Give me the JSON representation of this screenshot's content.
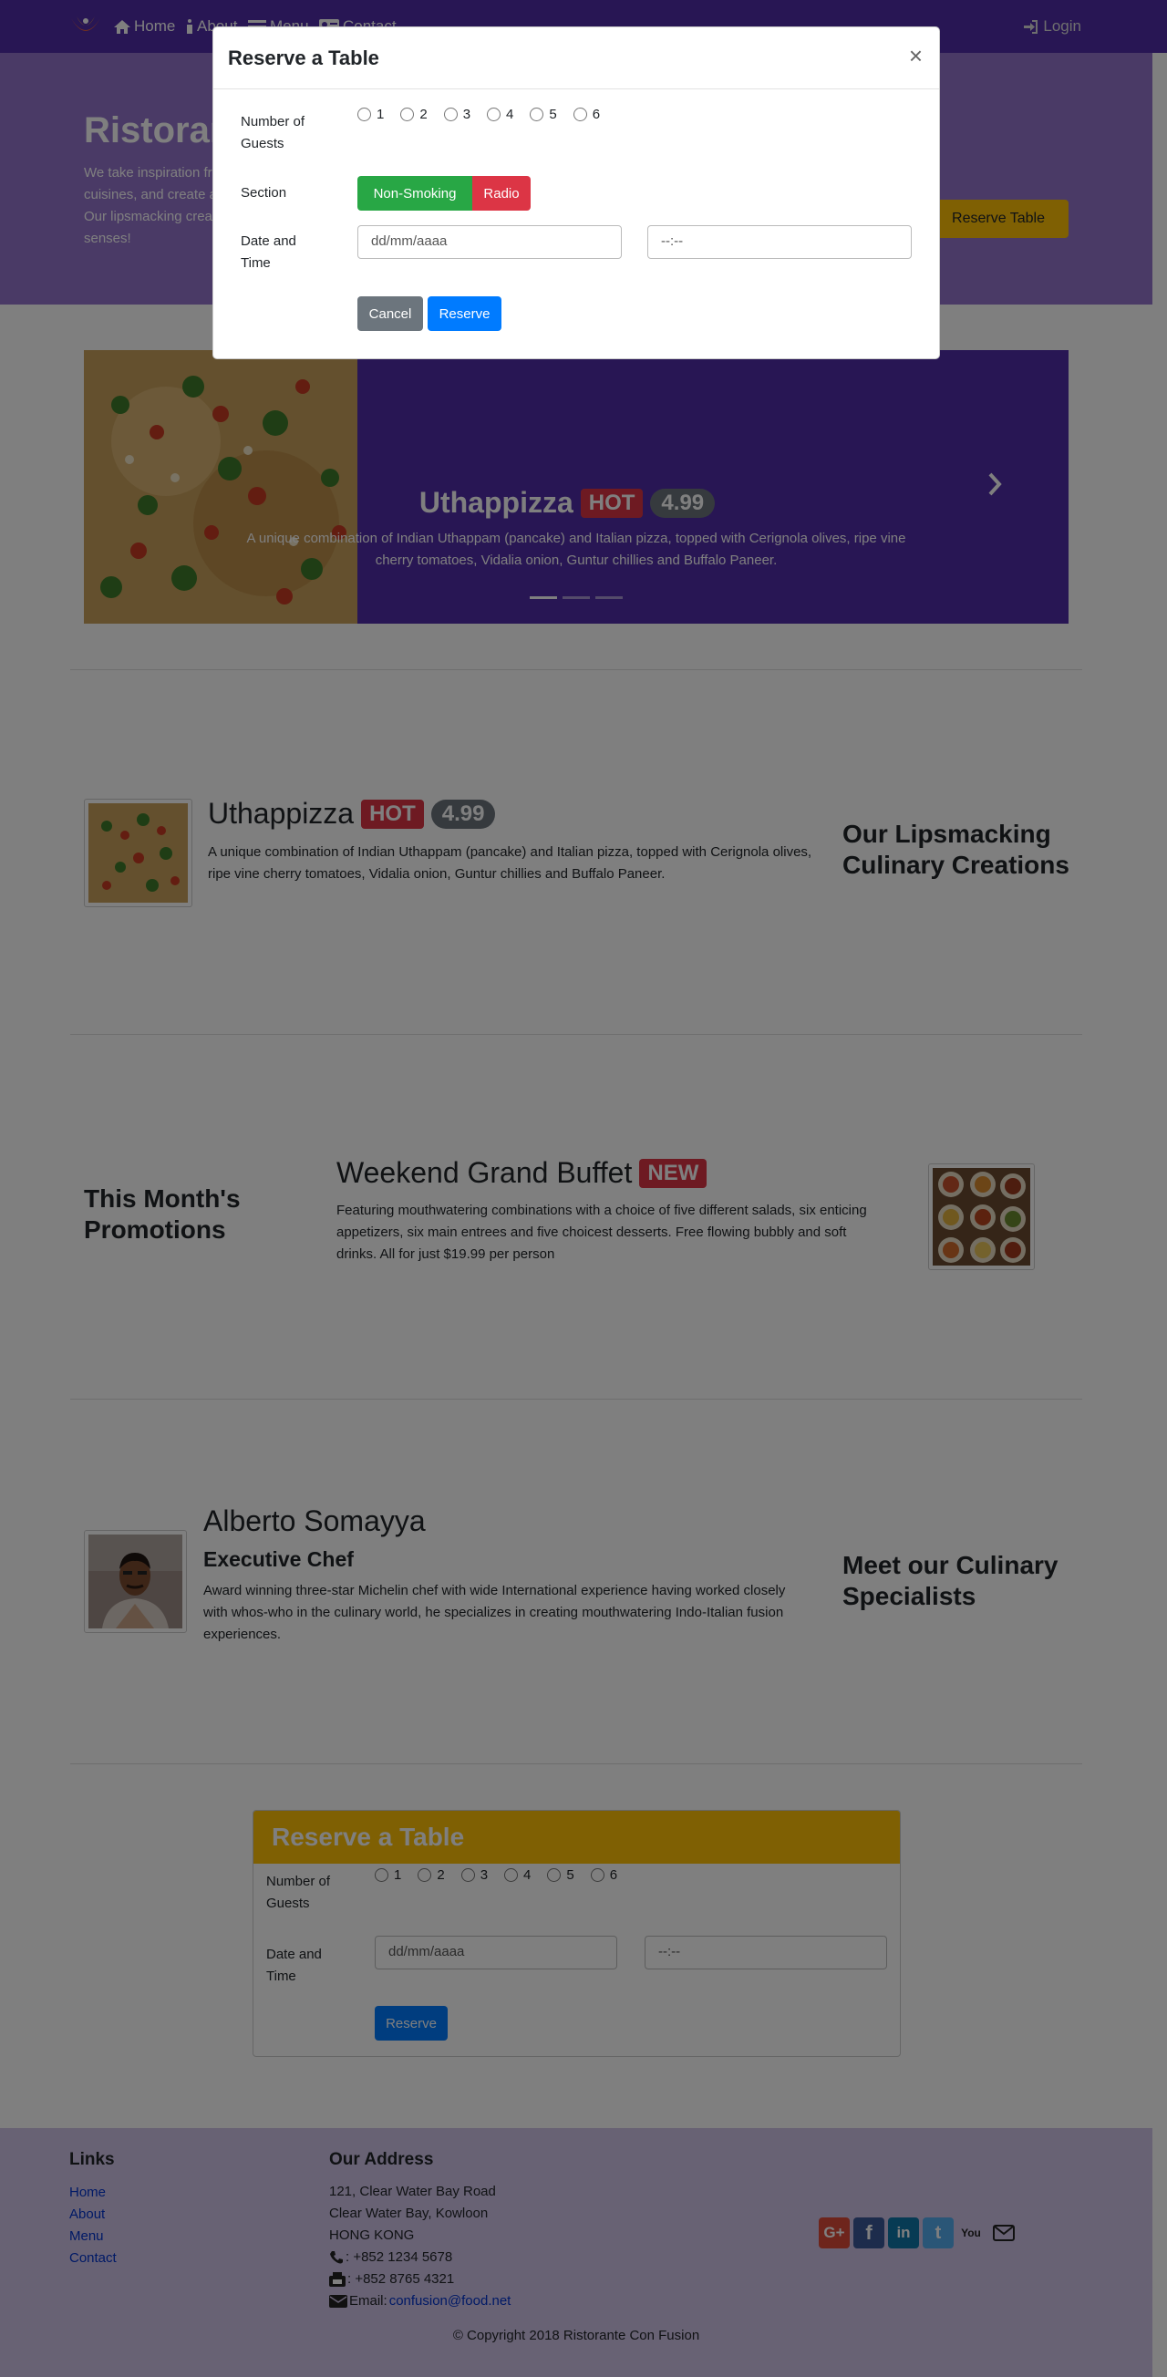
{
  "navbar": {
    "home": "Home",
    "about": "About",
    "menu": "Menu",
    "contact": "Contact",
    "login": "Login"
  },
  "jumbotron": {
    "title": "Ristorante Con Fusion",
    "text": "We take inspiration from the World's best cuisines, and create a unique fusion experience. Our lipsmacking creations will tickle your culinary senses!",
    "button": "Reserve Table"
  },
  "carousel": {
    "title": "Uthappizza",
    "badge": "HOT",
    "price": "4.99",
    "description": "A unique combination of Indian Uthappam (pancake) and Italian pizza, topped with Cerignola olives, ripe vine cherry tomatoes, Vidalia onion, Guntur chillies and Buffalo Paneer."
  },
  "dish": {
    "title": "Uthappizza",
    "badge": "HOT",
    "price": "4.99",
    "description": "A unique combination of Indian Uthappam (pancake) and Italian pizza, topped with Cerignola olives, ripe vine cherry tomatoes, Vidalia onion, Guntur chillies and Buffalo Paneer.",
    "side_heading": "Our Lipsmacking Culinary Creations"
  },
  "promotion": {
    "side_heading": "This Month's Promotions",
    "title": "Weekend Grand Buffet",
    "badge": "NEW",
    "description": "Featuring mouthwatering combinations with a choice of five different salads, six enticing appetizers, six main entrees and five choicest desserts. Free flowing bubbly and soft drinks. All for just $19.99 per person"
  },
  "leader": {
    "name": "Alberto Somayya",
    "role": "Executive Chef",
    "description": "Award winning three-star Michelin chef with wide International experience having worked closely with whos-who in the culinary world, he specializes in creating mouthwatering Indo-Italian fusion experiences.",
    "side_heading": "Meet our Culinary Specialists"
  },
  "reserve_card": {
    "header": "Reserve a Table",
    "guests_label": "Number of Guests",
    "guest_options": [
      "1",
      "2",
      "3",
      "4",
      "5",
      "6"
    ],
    "datetime_label": "Date and Time",
    "date_placeholder": "dd/mm/aaaa",
    "time_placeholder": "--:--",
    "submit": "Reserve"
  },
  "footer": {
    "links_heading": "Links",
    "links": [
      "Home",
      "About",
      "Menu",
      "Contact"
    ],
    "address_heading": "Our Address",
    "address": [
      "121, Clear Water Bay Road",
      "Clear Water Bay, Kowloon",
      "HONG KONG"
    ],
    "phone": ": +852 1234 5678",
    "fax": ": +852 8765 4321",
    "email_label": "Email: ",
    "email": "confusion@food.net",
    "copyright": "© Copyright 2018 Ristorante Con Fusion",
    "socials": {
      "google": "G+",
      "facebook": "f",
      "linkedin": "in",
      "twitter": "t",
      "youtube": "You"
    }
  },
  "modal": {
    "title": "Reserve a Table",
    "close": "×",
    "guests_label": "Number of Guests",
    "guest_options": [
      "1",
      "2",
      "3",
      "4",
      "5",
      "6"
    ],
    "section_label": "Section",
    "section_non_smoking": "Non-Smoking",
    "section_smoking": "Radio",
    "datetime_label": "Date and Time",
    "date_placeholder": "dd/mm/aaaa",
    "time_placeholder": "--:--",
    "cancel": "Cancel",
    "reserve": "Reserve"
  },
  "colors": {
    "primary_dark": "#512DA8",
    "primary": "#9575CD",
    "primary_light": "#D1C4E9",
    "accent": "#FFC107",
    "danger": "#DC3545",
    "success": "#28A745",
    "blue": "#007BFF"
  }
}
